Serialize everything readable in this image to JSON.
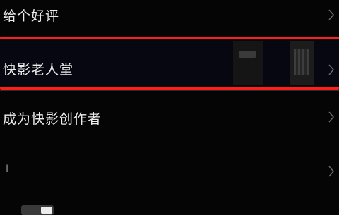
{
  "rows": [
    {
      "label": "给个好评"
    },
    {
      "label": "快影老人堂"
    },
    {
      "label": "成为快影创作者"
    },
    {
      "label": "I"
    }
  ],
  "icons": {
    "chevron": "chevron-right-icon"
  },
  "colors": {
    "background": "#050505",
    "highlight": "#ff1e1e",
    "text": "#ececec"
  },
  "toggle": {
    "state": "on"
  }
}
